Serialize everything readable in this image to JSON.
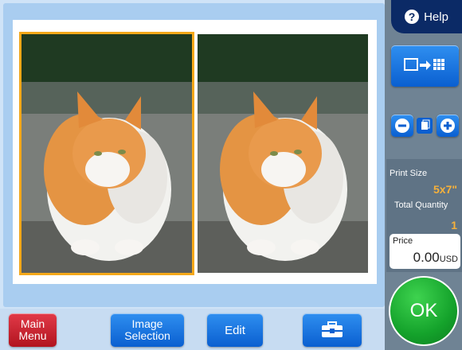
{
  "photos": [
    {
      "subject": "cat",
      "selected": true
    },
    {
      "subject": "cat",
      "selected": false
    }
  ],
  "bottom_bar": {
    "main_menu_line1": "Main",
    "main_menu_line2": "Menu",
    "image_selection_line1": "Image",
    "image_selection_line2": "Selection",
    "edit_label": "Edit",
    "tools_icon": "toolbox-icon"
  },
  "side_panel": {
    "help_label": "Help",
    "layout_icon": "layout-grid-icon",
    "zoom_out_icon": "minus-icon",
    "page_icon": "page-icon",
    "zoom_in_icon": "plus-icon",
    "print_size_label": "Print Size",
    "print_size_value": "5x7\"",
    "total_quantity_label": "Total Quantity",
    "total_quantity_value": "1",
    "price_label": "Price",
    "price_amount": "0.00",
    "price_currency": "USD",
    "ok_label": "OK"
  },
  "colors": {
    "selection_border": "#f4a81a",
    "accent_blue": "#0a5fd0",
    "ok_green": "#14a22b",
    "menu_red": "#b1141f",
    "value_orange": "#f6b13b"
  }
}
